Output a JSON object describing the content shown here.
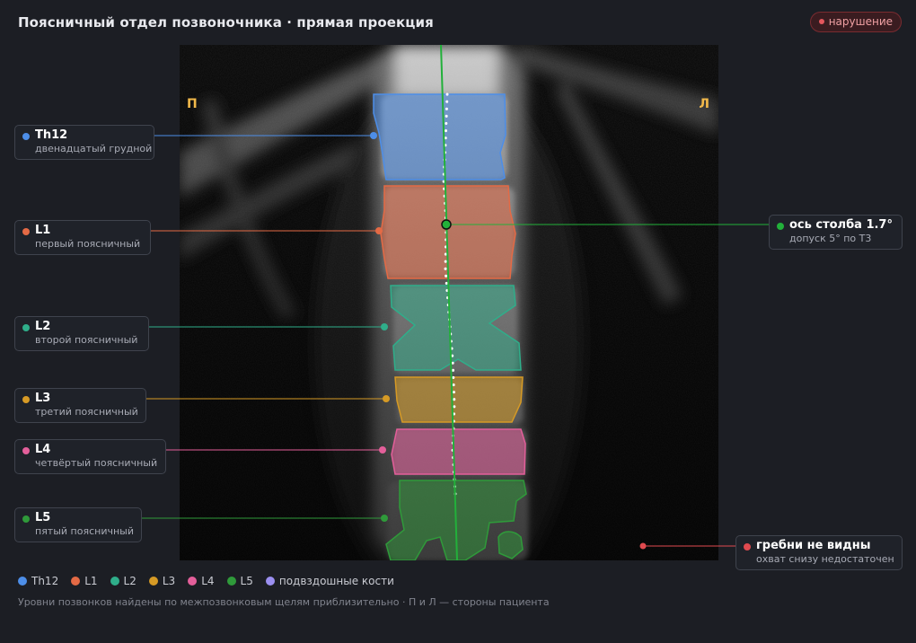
{
  "header": {
    "title": "Поясничный отдел позвоночника · прямая проекция",
    "badge": "нарушение"
  },
  "sides": {
    "left": "П",
    "right": "Л"
  },
  "colors": {
    "th12": "#4d8ee8",
    "l1": "#e46a45",
    "l2": "#2fae8a",
    "l3": "#d69a25",
    "l4": "#e35f9a",
    "l5": "#2f9a3a",
    "iliac": "#9b8ff0",
    "warning": "#e04a4f",
    "axis": "#22b03a"
  },
  "vertebrae": [
    {
      "id": "th12",
      "label": "Th12",
      "sub": "двенадцатый грудной"
    },
    {
      "id": "l1",
      "label": "L1",
      "sub": "первый поясничный"
    },
    {
      "id": "l2",
      "label": "L2",
      "sub": "второй поясничный"
    },
    {
      "id": "l3",
      "label": "L3",
      "sub": "третий поясничный"
    },
    {
      "id": "l4",
      "label": "L4",
      "sub": "четвёртый поясничный"
    },
    {
      "id": "l5",
      "label": "L5",
      "sub": "пятый поясничный"
    }
  ],
  "axis_callout": {
    "label": "ось столба 1.7°",
    "sub": "допуск 5° по Т3"
  },
  "crest_callout": {
    "label": "гребни не видны",
    "sub": "охват снизу недостаточен"
  },
  "legend": {
    "th12": "Th12",
    "l1": "L1",
    "l2": "L2",
    "l3": "L3",
    "l4": "L4",
    "l5": "L5",
    "iliac": "подвздошные кости"
  },
  "footnote": "Уровни позвонков найдены по межпозвонковым щелям приблизительно · П и Л — стороны пациента"
}
